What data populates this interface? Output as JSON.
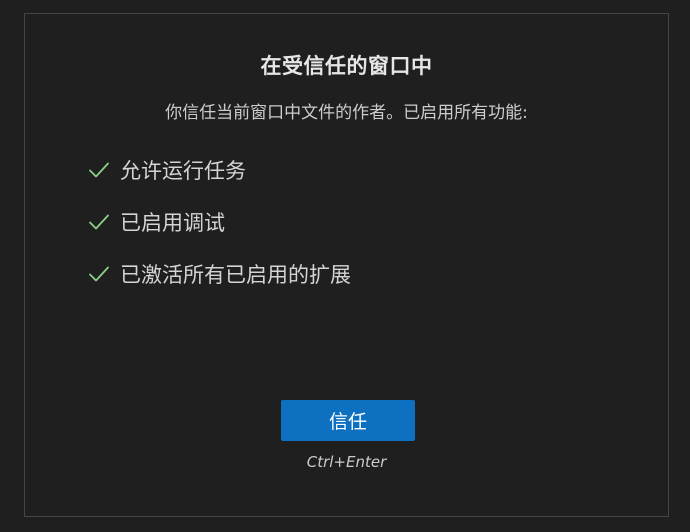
{
  "dialog": {
    "title": "在受信任的窗口中",
    "subtitle": "你信任当前窗口中文件的作者。已启用所有功能:",
    "features": [
      {
        "label": "允许运行任务",
        "icon": "checkmark-icon"
      },
      {
        "label": "已启用调试",
        "icon": "checkmark-icon"
      },
      {
        "label": "已激活所有已启用的扩展",
        "icon": "checkmark-icon"
      }
    ],
    "trust_button_label": "信任",
    "shortcut_hint": "Ctrl+Enter"
  },
  "colors": {
    "background": "#1f1f1f",
    "border": "#454545",
    "check": "#89d185",
    "button": "#0e70c0"
  }
}
